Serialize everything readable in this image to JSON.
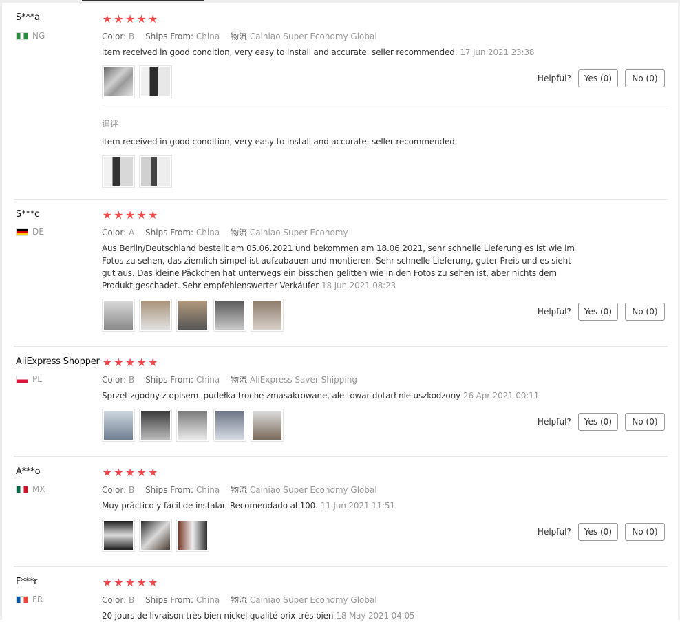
{
  "colors": {
    "star": "#f44c4c",
    "meta_gray": "#999999",
    "separator": "#e8e8e8"
  },
  "labels": {
    "color": "Color:",
    "ships_from": "Ships From:",
    "logistics": "物流",
    "helpful": "Helpful?"
  },
  "reviews": [
    {
      "user": "S***a",
      "country": "NG",
      "stars": 5,
      "color_value": "B",
      "ships_from": "China",
      "logistics": "Cainiao Super Economy Global",
      "text": "item received in good condition, very easy to install and accurate. seller recommended.",
      "date": "17 Jun 2021 23:38",
      "yes": "Yes (0)",
      "no": "No (0)",
      "photos": 2,
      "followup": {
        "label": "追评",
        "text": "item received in good condition, very easy to install and accurate. seller recommended.",
        "photos": 2
      }
    },
    {
      "user": "S***c",
      "country": "DE",
      "stars": 5,
      "color_value": "A",
      "ships_from": "China",
      "logistics": "Cainiao Super Economy",
      "text_lines": [
        "Aus Berlin/Deutschland bestellt am 05.06.2021 und bekommen am 18.06.2021, sehr schnelle Lieferung es ist wie im",
        "Fotos zu sehen, das ziemlich simpel ist aufzubauen und montieren. Sehr schnelle Lieferung, guter Preis und es sieht",
        "gut aus. Das kleine Päckchen hat unterwegs ein bisschen gelitten wie in den Fotos zu sehen ist, aber nichts dem",
        "Produkt geschadet. Sehr empfehlenswerter Verkäufer"
      ],
      "date": "18 Jun 2021 08:23",
      "yes": "Yes (0)",
      "no": "No (0)",
      "photos": 5
    },
    {
      "user": "AliExpress Shopper",
      "country": "PL",
      "stars": 5,
      "color_value": "B",
      "ships_from": "China",
      "logistics": "AliExpress Saver Shipping",
      "text": "Sprzęt zgodny z opisem. pudełka trochę zmasakrowane, ale towar dotarł nie uszkodzony",
      "date": "26 Apr 2021 00:11",
      "yes": "Yes (0)",
      "no": "No (0)",
      "photos": 5
    },
    {
      "user": "A***o",
      "country": "MX",
      "stars": 5,
      "color_value": "B",
      "ships_from": "China",
      "logistics": "Cainiao Super Economy Global",
      "text": "Muy práctico y fácil de instalar. Recomendado al 100.",
      "date": "11 Jun 2021 11:51",
      "yes": "Yes (0)",
      "no": "No (0)",
      "photos": 3
    },
    {
      "user": "F***r",
      "country": "FR",
      "stars": 5,
      "color_value": "B",
      "ships_from": "China",
      "logistics": "Cainiao Super Economy Global",
      "text": "20 jours de livraison très bien nickel qualité prix très bien",
      "date": "18 May 2021 04:05"
    }
  ]
}
